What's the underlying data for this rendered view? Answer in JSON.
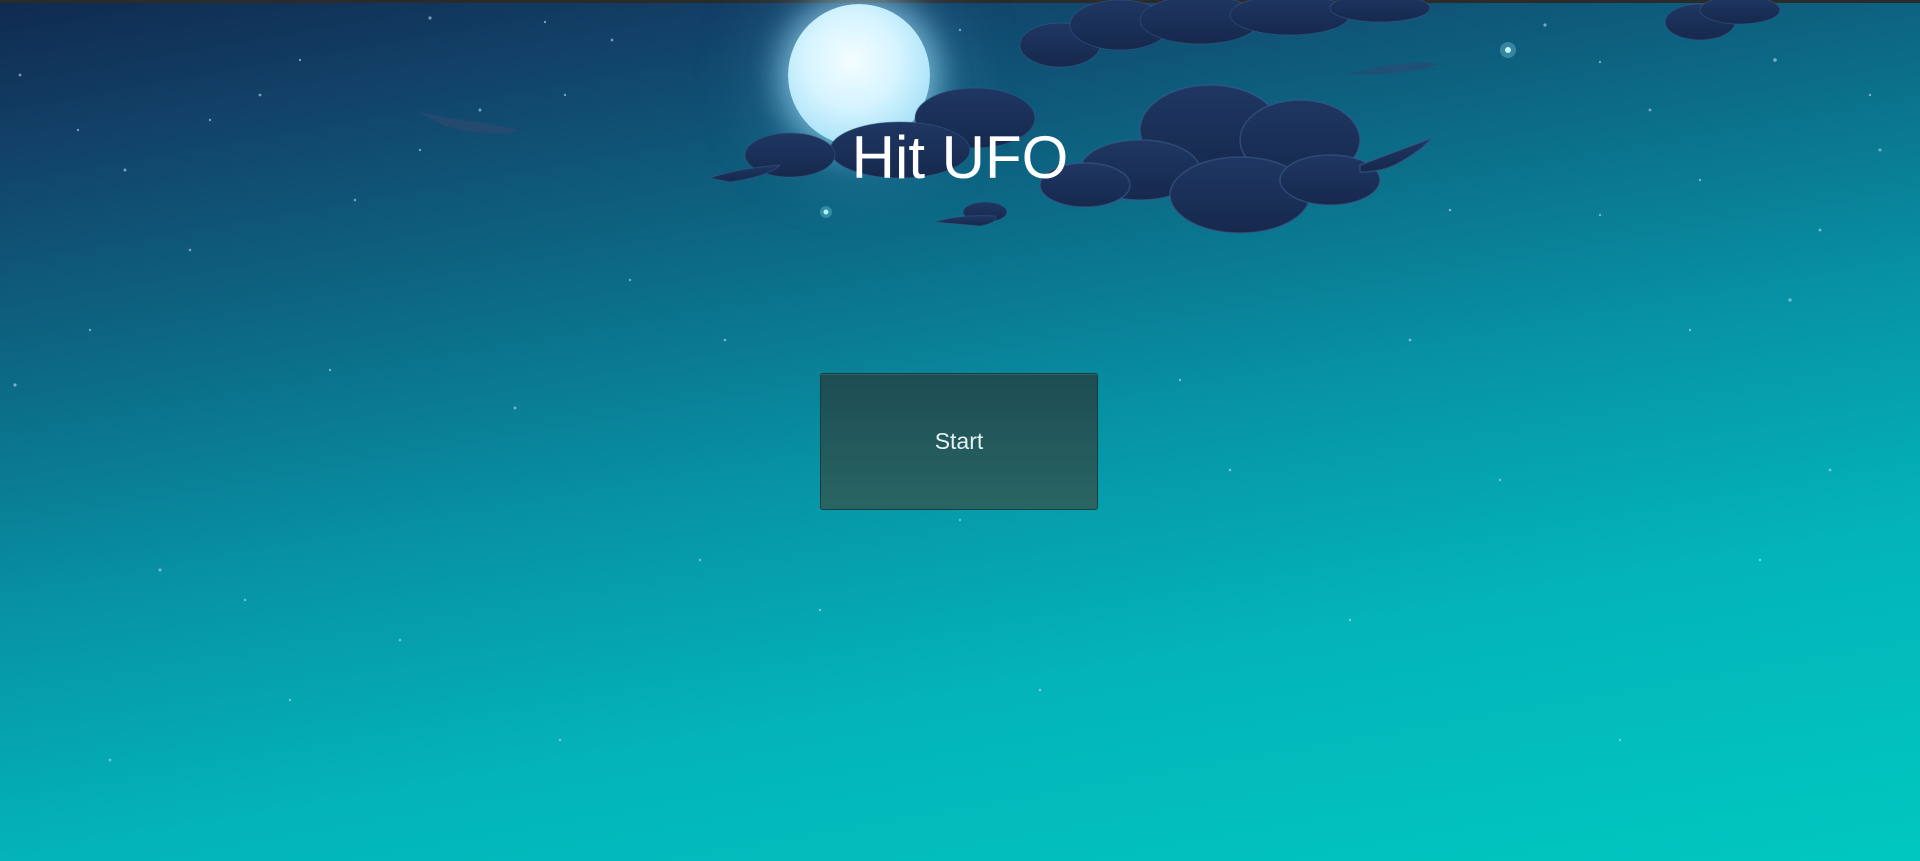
{
  "game": {
    "title": "Hit UFO",
    "start_label": "Start"
  },
  "colors": {
    "sky_top": "#102a4f",
    "sky_bottom": "#00c8c0",
    "button_fill": "#23595c",
    "text": "#ffffff"
  },
  "icons": [
    "moon-icon",
    "cloud-icon",
    "star-icon",
    "bird-silhouette-icon"
  ]
}
